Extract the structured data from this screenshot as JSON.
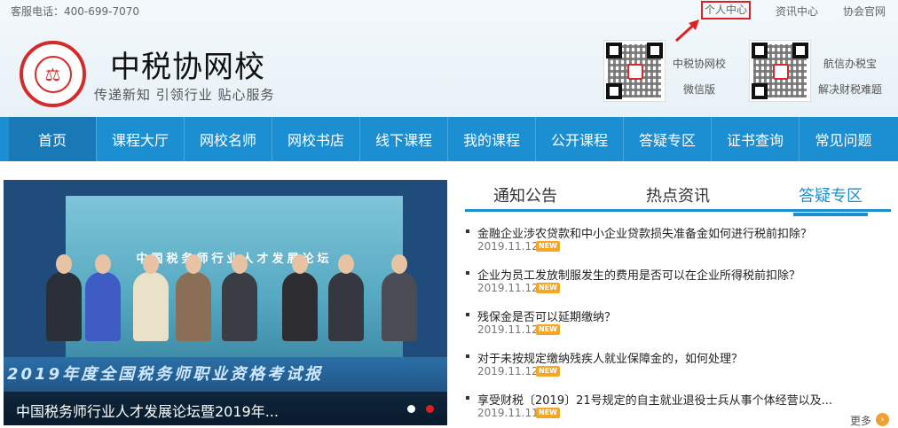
{
  "topbar": {
    "hotline": "客服电话：400-699-7070",
    "links": [
      {
        "label": "个人中心",
        "active": true
      },
      {
        "label": "资讯中心",
        "active": false
      },
      {
        "label": "协会官网",
        "active": false
      }
    ]
  },
  "brand": {
    "name": "中税协网校",
    "slogan": "传递新知 引领行业 贴心服务",
    "accent": "#d42a2a"
  },
  "qrcodes": [
    {
      "label1": "中税协网校",
      "label2": "微信版"
    },
    {
      "label1": "航信办税宝",
      "label2": "解决财税难题"
    }
  ],
  "nav": {
    "color": "#1c8fd2",
    "items": [
      "首页",
      "课程大厅",
      "网校名师",
      "网校书店",
      "线下课程",
      "我的课程",
      "公开课程",
      "答疑专区",
      "证书查询",
      "常见问题"
    ]
  },
  "banner": {
    "caption": "中国税务师行业人才发展论坛暨2019年...",
    "wall_text": "中国税务师行业人才发展论坛",
    "stripe_text": "2019年度全国税务师职业资格考试报",
    "active_dot": 2
  },
  "tabs": [
    {
      "label": "通知公告",
      "active": false
    },
    {
      "label": "热点资讯",
      "active": false
    },
    {
      "label": "答疑专区",
      "active": true
    }
  ],
  "news": [
    {
      "title": "金融企业涉农贷款和中小企业贷款损失准备金如何进行税前扣除？",
      "date": "2019.11.12",
      "badge": "NEW"
    },
    {
      "title": "企业为员工发放制服发生的费用是否可以在企业所得税前扣除？",
      "date": "2019.11.12",
      "badge": "NEW"
    },
    {
      "title": "残保金是否可以延期缴纳？",
      "date": "2019.11.12",
      "badge": "NEW"
    },
    {
      "title": "对于未按规定缴纳残疾人就业保障金的，如何处理？",
      "date": "2019.11.12",
      "badge": "NEW"
    },
    {
      "title": "享受财税〔2019〕21号规定的自主就业退役士兵从事个体经营以及...",
      "date": "2019.11.11",
      "badge": "NEW"
    }
  ],
  "more_label": "更多"
}
